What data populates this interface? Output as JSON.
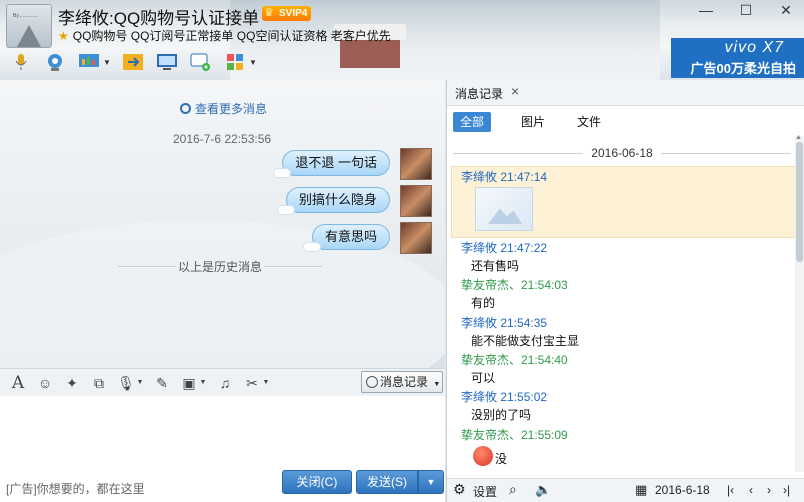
{
  "window": {
    "title": "李绛攸:QQ购物号认证接单",
    "svip_badge": "SVIP4",
    "subtitle": "QQ购物号 QQ订阅号正常接单 QQ空间认证资格 老客户优先",
    "controls": [
      "—",
      "☐",
      "✕"
    ]
  },
  "ad_banner": {
    "brand": "vivo X7",
    "slogan": "广告00万柔光自拍"
  },
  "toolbar_icons": [
    "microphone-icon",
    "video-call-icon",
    "screen-share-icon",
    "file-transfer-icon",
    "remote-desktop-icon",
    "new-chat-icon",
    "apps-icon"
  ],
  "chat": {
    "view_more": "查看更多消息",
    "timestamp": "2016-7-6 22:53:56",
    "messages": [
      {
        "text": "退不退  一句话"
      },
      {
        "text": "别搞什么隐身"
      },
      {
        "text": "有意思吗"
      }
    ],
    "history_divider": "以上是历史消息"
  },
  "input_toolbar": {
    "message_record_label": "消息记录"
  },
  "input": {
    "ad_text": "[广告]你想要的，都在这里",
    "close_label": "关闭(C)",
    "send_label": "发送(S)"
  },
  "history_panel": {
    "tab_label": "消息记录",
    "filters": [
      "全部",
      "图片",
      "文件"
    ],
    "date": "2016-06-18",
    "entries": [
      {
        "sender": "李绛攸  21:47:14",
        "kind": "me",
        "image": true
      },
      {
        "sender": "李绛攸  21:47:22",
        "kind": "me",
        "text": "还有售吗"
      },
      {
        "sender": "挚友帝杰、21:54:03",
        "kind": "friend",
        "text": "有的"
      },
      {
        "sender": "李绛攸  21:54:35",
        "kind": "me",
        "text": "能不能做支付宝主显"
      },
      {
        "sender": "挚友帝杰、21:54:40",
        "kind": "friend",
        "text": "可以"
      },
      {
        "sender": "李绛攸  21:55:02",
        "kind": "me",
        "text": "没别的了吗"
      },
      {
        "sender": "挚友帝杰、21:55:09",
        "kind": "friend",
        "text": "没"
      }
    ],
    "footer": {
      "settings_label": "设置",
      "date_value": "2016-6-18"
    }
  }
}
